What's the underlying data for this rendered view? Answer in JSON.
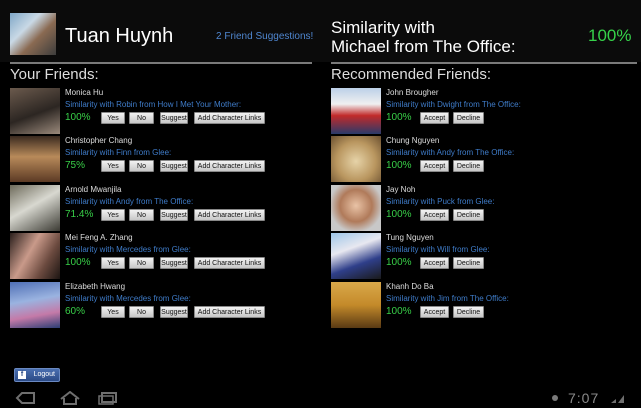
{
  "header": {
    "user_name": "Tuan Huynh",
    "suggestions_link": "2 Friend Suggestions!",
    "similarity_line1": "Similarity with",
    "similarity_line2": "Michael from The Office:",
    "similarity_value": "100%"
  },
  "friends": {
    "title": "Your Friends:",
    "buttons": {
      "yes": "Yes",
      "no": "No",
      "suggest": "Suggest",
      "add": "Add Character Links"
    },
    "items": [
      {
        "name": "Monica Hu",
        "similarity": "Similarity with Robin from How I Met Your Mother:",
        "percent": "100%"
      },
      {
        "name": "Christopher Chang",
        "similarity": "Similarity with Finn from Glee:",
        "percent": "75%"
      },
      {
        "name": "Arnold Mwanjila",
        "similarity": "Similarity with Andy from The Office:",
        "percent": "71.4%"
      },
      {
        "name": "Mei Feng A. Zhang",
        "similarity": "Similarity with Mercedes from Glee:",
        "percent": "100%"
      },
      {
        "name": "Elizabeth Hwang",
        "similarity": "Similarity with Mercedes from Glee:",
        "percent": "60%"
      }
    ]
  },
  "recommended": {
    "title": "Recommended Friends:",
    "buttons": {
      "accept": "Accept",
      "decline": "Decline"
    },
    "items": [
      {
        "name": "John Brougher",
        "similarity": "Similarity with Dwight from The Office:",
        "percent": "100%"
      },
      {
        "name": "Chung Nguyen",
        "similarity": "Similarity with Andy from The Office:",
        "percent": "100%"
      },
      {
        "name": "Jay Noh",
        "similarity": "Similarity with Puck from Glee:",
        "percent": "100%"
      },
      {
        "name": "Tung Nguyen",
        "similarity": "Similarity with Will from Glee:",
        "percent": "100%"
      },
      {
        "name": "Khanh Do Ba",
        "similarity": "Similarity with Jim from The Office:",
        "percent": "100%"
      }
    ]
  },
  "logout_label": "Logout",
  "status": {
    "clock": "7:07"
  },
  "colors": {
    "accent_green": "#36d24a",
    "link_blue": "#4f86cf",
    "similarity_blue": "#3f7cc9"
  }
}
